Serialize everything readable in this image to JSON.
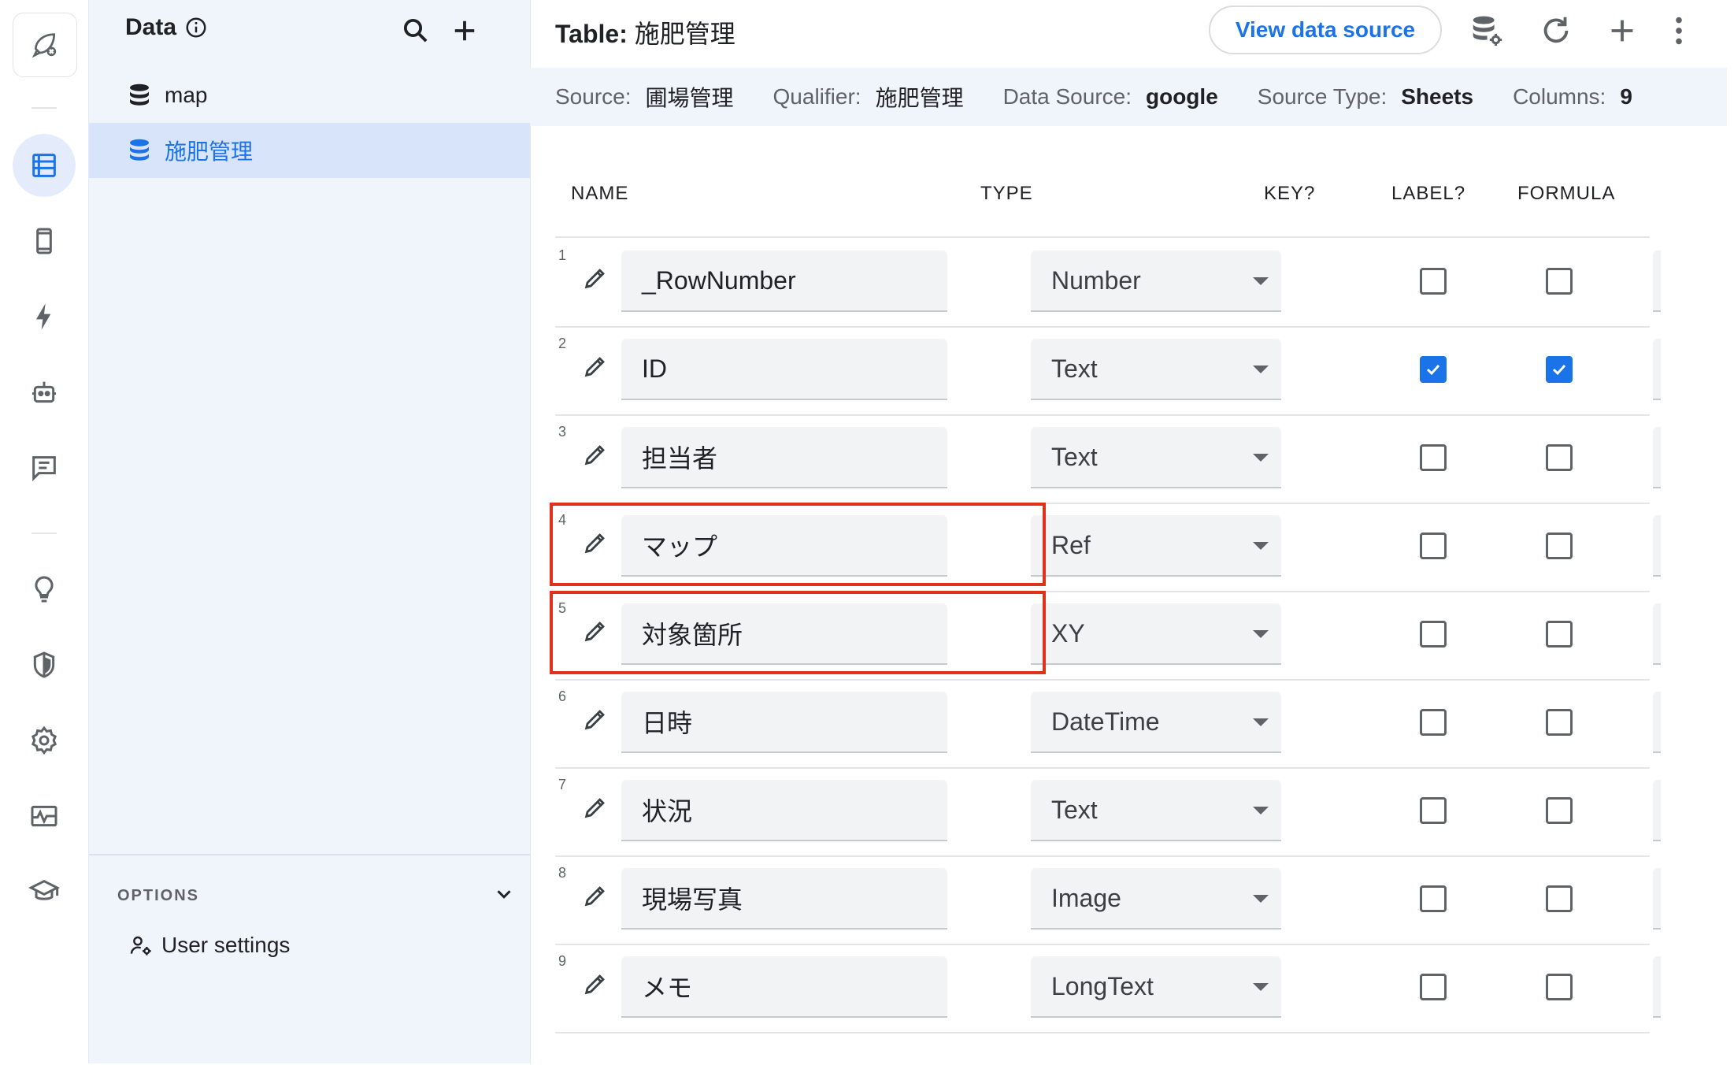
{
  "sidebar": {
    "title": "Data",
    "tables": [
      {
        "label": "map"
      },
      {
        "label": "施肥管理"
      }
    ],
    "options_label": "OPTIONS",
    "user_settings": "User settings"
  },
  "header": {
    "title_prefix": "Table:",
    "title_name": "施肥管理",
    "view_source_btn": "View data source"
  },
  "info": {
    "source_label": "Source:",
    "source": "圃場管理",
    "qualifier_label": "Qualifier:",
    "qualifier": "施肥管理",
    "datasource_label": "Data Source:",
    "datasource": "google",
    "sourcetype_label": "Source Type:",
    "sourcetype": "Sheets",
    "columns_label": "Columns:",
    "columns": "9"
  },
  "columns_header": {
    "name": "NAME",
    "type": "TYPE",
    "key": "KEY?",
    "label": "LABEL?",
    "formula": "FORMULA"
  },
  "rows": [
    {
      "num": "1",
      "name": "_RowNumber",
      "type": "Number",
      "key": false,
      "label": false,
      "formula": "="
    },
    {
      "num": "2",
      "name": "ID",
      "type": "Text",
      "key": true,
      "label": true,
      "formula": "="
    },
    {
      "num": "3",
      "name": "担当者",
      "type": "Text",
      "key": false,
      "label": false,
      "formula": "="
    },
    {
      "num": "4",
      "name": "マップ",
      "type": "Ref",
      "key": false,
      "label": false,
      "formula": "="
    },
    {
      "num": "5",
      "name": "対象箇所",
      "type": "XY",
      "key": false,
      "label": false,
      "formula": "="
    },
    {
      "num": "6",
      "name": "日時",
      "type": "DateTime",
      "key": false,
      "label": false,
      "formula": "="
    },
    {
      "num": "7",
      "name": "状況",
      "type": "Text",
      "key": false,
      "label": false,
      "formula": "="
    },
    {
      "num": "8",
      "name": "現場写真",
      "type": "Image",
      "key": false,
      "label": false,
      "formula": "="
    },
    {
      "num": "9",
      "name": "メモ",
      "type": "LongText",
      "key": false,
      "label": false,
      "formula": "="
    }
  ],
  "highlighted_rows": [
    "4",
    "5"
  ],
  "colors": {
    "accent": "#1a73e8",
    "highlight": "#e0301e",
    "sidebar_bg": "#f0f4fb"
  }
}
